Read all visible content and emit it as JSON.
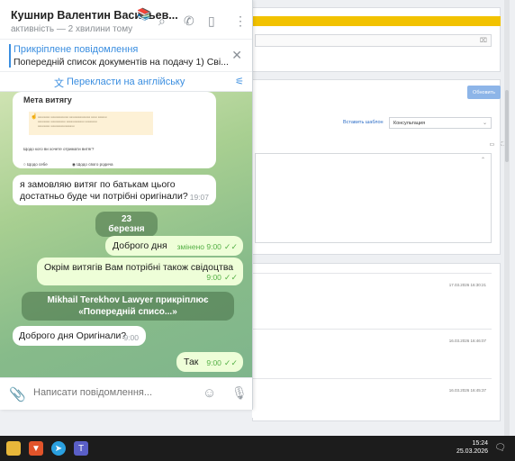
{
  "chat": {
    "contact_name": "Кушнир Валентин Васильев...",
    "status": "активність — 2 хвилини тому",
    "pinned": {
      "title": "Прикріплене повідомлення",
      "text": "Попередній список документів на подачу  1) Сві..."
    },
    "translate_label": "Перекласти на англійську",
    "screenshot": {
      "title": "Мета витягу",
      "question": "Щодо кого ви хочете отримати витяг?",
      "option_self": "Щодо себе",
      "option_relative": "Щодо свого родича"
    },
    "messages": [
      {
        "text": "я замовляю витяг по батькам цього достатньо буде чи потрібні оригінали?",
        "time": "19:07"
      },
      {
        "text": "Доброго дня",
        "time": "змінено 9:00"
      },
      {
        "text": "Окрім витягів Вам потрібні також свідоцтва",
        "time": "9:00"
      },
      {
        "text": "Доброго дня Оригінали?",
        "time": "9:00"
      },
      {
        "text": "Так",
        "time": "9:00"
      }
    ],
    "date_separator": "23 березня",
    "service_message": "Mikhail Terekhov Lawyer прикріплює «Попередній списо...»",
    "composer_placeholder": "Написати повідомлення..."
  },
  "background": {
    "refresh_button": "Обновить",
    "insert_template": "Вставить шаблон",
    "consultation_select": "Консультация",
    "log_dates": [
      "17.03.2026 16:30:21",
      "16.03.2026 16:46:07",
      "16.03.2026 16:45:37"
    ]
  },
  "taskbar": {
    "time": "15:24",
    "date": "25.03.2026"
  }
}
